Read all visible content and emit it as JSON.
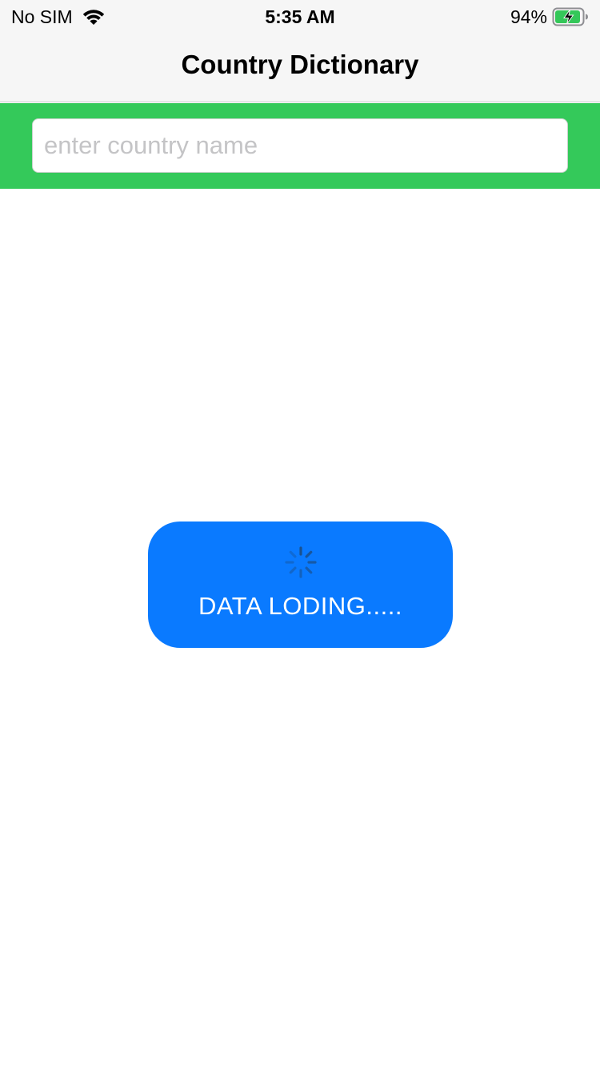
{
  "status_bar": {
    "carrier": "No SIM",
    "time": "5:35 AM",
    "battery_percent": "94%",
    "battery_level": 0.94,
    "battery_charging": true,
    "icons": [
      "wifi-icon",
      "battery-charging-icon"
    ]
  },
  "nav": {
    "title": "Country Dictionary"
  },
  "search": {
    "value": "",
    "placeholder": "enter country name"
  },
  "loading": {
    "text": "DATA LODING.....",
    "icon": "spinner-icon"
  },
  "colors": {
    "search_bar_background": "#34c95a",
    "loading_background": "#0a7aff",
    "nav_background": "#f6f6f6",
    "battery_fill": "#34c759"
  }
}
